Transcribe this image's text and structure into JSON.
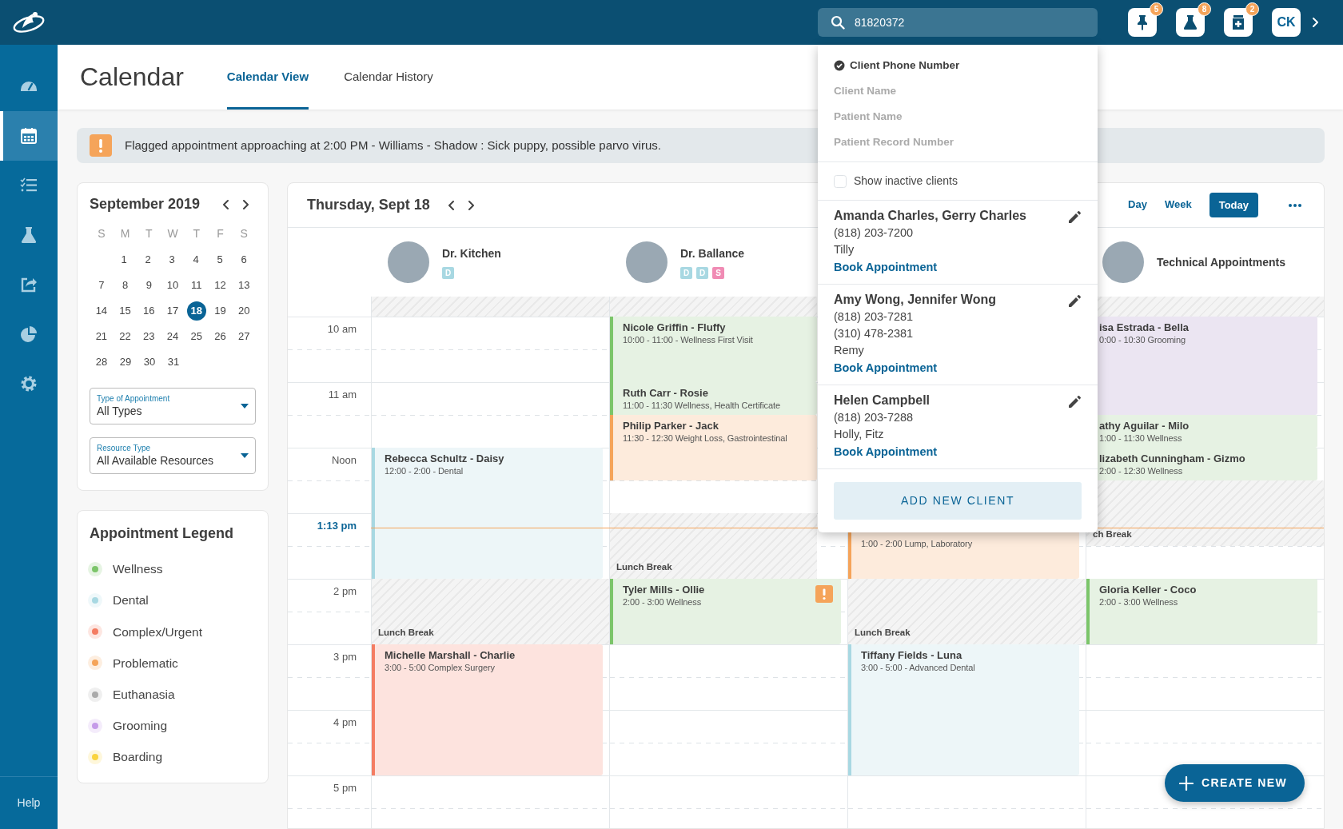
{
  "sidebar": {
    "items": [
      {
        "kind": "dashboard",
        "selected": false
      },
      {
        "kind": "calendar",
        "selected": true
      },
      {
        "kind": "tasks",
        "selected": false
      },
      {
        "kind": "lab",
        "selected": false
      },
      {
        "kind": "export",
        "selected": false
      },
      {
        "kind": "reports",
        "selected": false
      },
      {
        "kind": "settings",
        "selected": false
      }
    ],
    "help": "Help"
  },
  "topbar": {
    "search": {
      "value": "81820372"
    },
    "actions": [
      {
        "kind": "pin",
        "count": "5"
      },
      {
        "kind": "lab",
        "count": "8"
      },
      {
        "kind": "pharmacy",
        "count": "2"
      }
    ],
    "user_initials": "CK"
  },
  "search_menu": {
    "options": [
      {
        "label": "Client Phone Number",
        "selected": true
      },
      {
        "label": "Client Name",
        "selected": false
      },
      {
        "label": "Patient Name",
        "selected": false
      },
      {
        "label": "Patient Record Number",
        "selected": false
      }
    ],
    "show_inactive": {
      "label": "Show inactive clients",
      "checked": false
    },
    "results": [
      {
        "names": "Amanda Charles, Gerry Charles",
        "lines": [
          "(818) 203-7200",
          "Tilly"
        ],
        "link": "Book Appointment"
      },
      {
        "names": "Amy Wong, Jennifer Wong",
        "lines": [
          "(818) 203-7281",
          "(310) 478-2381",
          "Remy"
        ],
        "link": "Book Appointment"
      },
      {
        "names": "Helen Campbell",
        "lines": [
          "(818) 203-7288",
          "Holly, Fitz"
        ],
        "link": "Book Appointment"
      }
    ],
    "add_button": "ADD NEW CLIENT"
  },
  "page": {
    "title": "Calendar",
    "tabs": [
      {
        "label": "Calendar View",
        "selected": true
      },
      {
        "label": "Calendar History",
        "selected": false
      }
    ]
  },
  "alert": {
    "text": "Flagged appointment approaching at 2:00 PM - Williams - Shadow : Sick puppy, possible parvo virus."
  },
  "mini_calendar": {
    "title": "September 2019",
    "weekdays": [
      "S",
      "M",
      "T",
      "W",
      "T",
      "F",
      "S"
    ],
    "weeks": [
      [
        {
          "day": "1",
          "selected": false
        },
        {
          "day": "2",
          "selected": false
        },
        {
          "day": "3",
          "selected": false
        },
        {
          "day": "4",
          "selected": false
        },
        {
          "day": "5",
          "selected": false
        },
        {
          "day": "6",
          "selected": false
        }
      ],
      [
        {
          "day": "7",
          "selected": false
        },
        {
          "day": "8",
          "selected": false
        },
        {
          "day": "9",
          "selected": false
        },
        {
          "day": "10",
          "selected": false
        },
        {
          "day": "11",
          "selected": false
        },
        {
          "day": "12",
          "selected": false
        },
        {
          "day": "13",
          "selected": false
        }
      ],
      [
        {
          "day": "14",
          "selected": false
        },
        {
          "day": "15",
          "selected": false
        },
        {
          "day": "16",
          "selected": false
        },
        {
          "day": "17",
          "selected": false
        },
        {
          "day": "18",
          "selected": true
        },
        {
          "day": "19",
          "selected": false
        },
        {
          "day": "20",
          "selected": false
        }
      ],
      [
        {
          "day": "21",
          "selected": false
        },
        {
          "day": "22",
          "selected": false
        },
        {
          "day": "23",
          "selected": false
        },
        {
          "day": "24",
          "selected": false
        },
        {
          "day": "25",
          "selected": false
        },
        {
          "day": "26",
          "selected": false
        },
        {
          "day": "27",
          "selected": false
        }
      ],
      [
        {
          "day": "28",
          "selected": false
        },
        {
          "day": "29",
          "selected": false
        },
        {
          "day": "30",
          "selected": false
        },
        {
          "day": "31",
          "selected": false
        }
      ]
    ]
  },
  "filters": [
    {
      "label": "Type of Appointment",
      "value": "All Types"
    },
    {
      "label": "Resource Type",
      "value": "All Available Resources"
    }
  ],
  "legend": {
    "title": "Appointment Legend",
    "items": [
      {
        "label": "Wellness",
        "color": "#7cc56a"
      },
      {
        "label": "Dental",
        "color": "#a8d8e2"
      },
      {
        "label": "Complex/Urgent",
        "color": "#f47c62"
      },
      {
        "label": "Problematic",
        "color": "#f5a45a"
      },
      {
        "label": "Euthanasia",
        "color": "#aaaaaa"
      },
      {
        "label": "Grooming",
        "color": "#c59be9"
      },
      {
        "label": "Boarding",
        "color": "#fad43f"
      }
    ]
  },
  "day_view": {
    "title": "Thursday, Sept 18",
    "views": [
      {
        "label": "Day",
        "selected": false
      },
      {
        "label": "Week",
        "selected": false
      }
    ],
    "today": "Today",
    "hours": [
      {
        "label": "10 am",
        "current": false
      },
      {
        "label": "11 am",
        "current": false
      },
      {
        "label": "Noon",
        "current": false
      },
      {
        "label": "1:13 pm",
        "current": true
      },
      {
        "label": "2 pm",
        "current": false
      },
      {
        "label": "3 pm",
        "current": false
      },
      {
        "label": "4 pm",
        "current": false
      },
      {
        "label": "5 pm",
        "current": false
      }
    ],
    "columns": [
      {
        "resource": {
          "name": "Dr. Kitchen",
          "tags": [
            {
              "label": "D",
              "color": "#a8d8e2"
            }
          ]
        },
        "events": [
          {
            "kind": "break"
          },
          {
            "kind": "dental",
            "title": "Rebecca Schultz - Daisy",
            "detail": "12:00 - 2:00 - Dental"
          },
          {
            "kind": "break",
            "label": "Lunch Break"
          },
          {
            "kind": "complex",
            "title": "Michelle Marshall - Charlie",
            "detail": "3:00 - 5:00 Complex Surgery"
          }
        ]
      },
      {
        "resource": {
          "name": "Dr. Ballance",
          "tags": [
            {
              "label": "D",
              "color": "#a8d8e2"
            },
            {
              "label": "D",
              "color": "#a8d8e2"
            },
            {
              "label": "S",
              "color": "#f08bb4"
            }
          ]
        },
        "events": [
          {
            "kind": "break"
          },
          {
            "kind": "wellness",
            "title": "Nicole Griffin - Fluffy",
            "detail": "10:00 - 11:00 - Wellness First Visit"
          },
          {
            "kind": "wellness",
            "title": "Ruth Carr - Rosie",
            "detail": "11:00 - 11:30 Wellness, Health Certificate"
          },
          {
            "kind": "problematic",
            "title": "Philip Parker - Jack",
            "detail": "11:30 - 12:30 Weight Loss, Gastrointestinal"
          },
          {
            "kind": "break",
            "label": "Lunch Break"
          },
          {
            "kind": "wellness",
            "title": "Tyler Mills - Ollie",
            "detail": "2:00 - 3:00 Wellness",
            "flagged": true
          }
        ]
      },
      {
        "events": [
          {
            "kind": "problematic",
            "detail": "1:00 - 2:00 Lump, Laboratory"
          },
          {
            "kind": "break",
            "label": "Lunch Break"
          },
          {
            "kind": "dental",
            "title": "Tiffany Fields - Luna",
            "detail": "3:00 - 5:00 - Advanced Dental"
          }
        ]
      },
      {
        "resource": {
          "name": "Technical Appointments"
        },
        "events": [
          {
            "kind": "break"
          },
          {
            "kind": "grooming",
            "title": "isa Estrada - Bella",
            "detail": "0:00 - 10:30 Grooming"
          },
          {
            "kind": "wellness",
            "title": "athy Aguilar - Milo",
            "detail": "1:00 - 11:30 Wellness"
          },
          {
            "kind": "wellness",
            "title": "lizabeth Cunningham - Gizmo",
            "detail": "2:00 - 12:30 Wellness"
          },
          {
            "kind": "break",
            "label": "ch Break"
          },
          {
            "kind": "wellness",
            "title": "Gloria Keller - Coco",
            "detail": "2:00 - 3:00 Wellness"
          }
        ]
      }
    ]
  },
  "create_button": "CREATE NEW"
}
